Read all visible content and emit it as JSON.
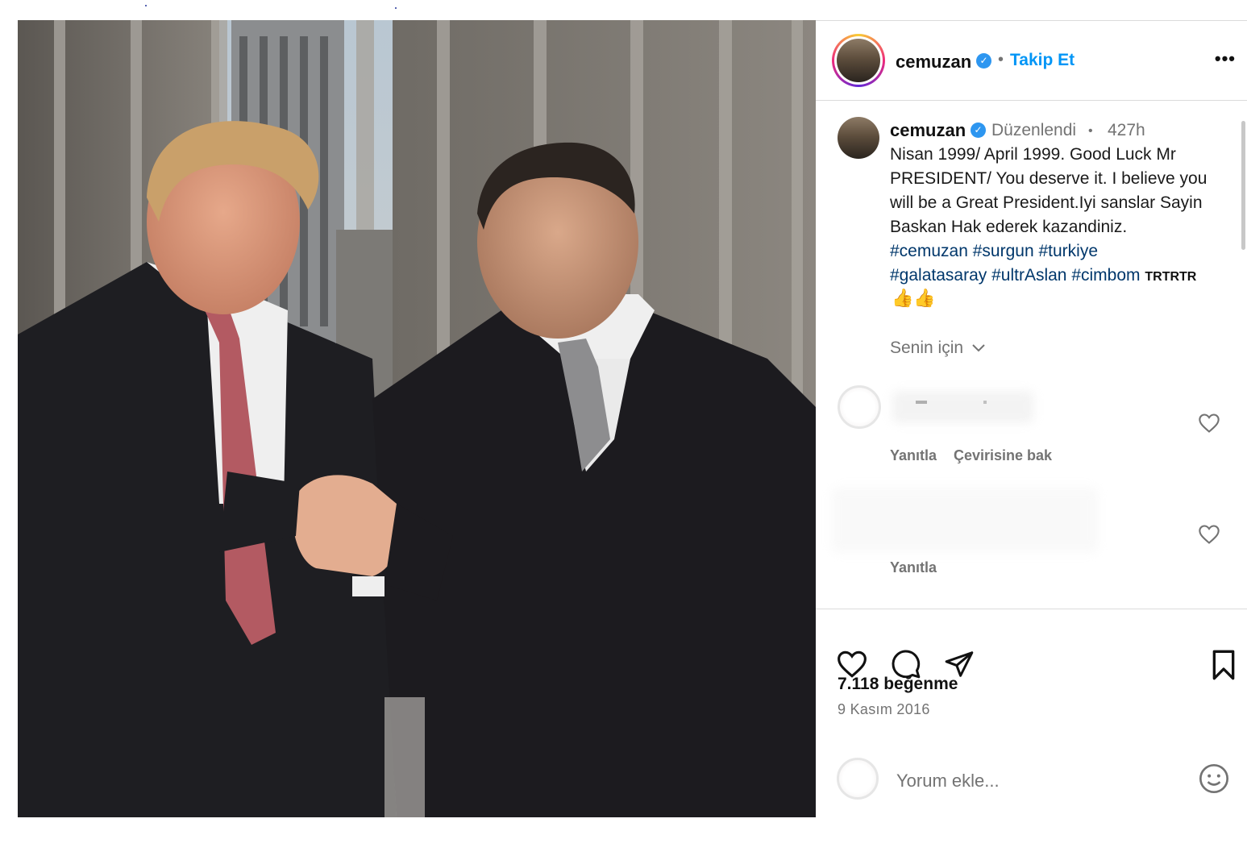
{
  "post": {
    "username": "cemuzan",
    "follow_label": "Takip Et",
    "more_label": "•••",
    "edited_label": "Düzenlendi",
    "time_ago": "427h",
    "caption_text": "Nisan 1999/ April 1999. Good Luck Mr PRESIDENT/ You deserve it. I believe you will be a Great President.Iyi sanslar Sayin Baskan Hak ederek kazandiniz.",
    "hashtags_line1": [
      "#cemuzan",
      "#surgun",
      "#turkiye"
    ],
    "hashtags_line2": [
      "#galatasaray",
      "#ultrAslan",
      "#cimbom"
    ],
    "caption_suffix": "TRTRTR",
    "emoji": "👍👍",
    "for_you_label": "Senin için",
    "likes": "7.118 beğenme",
    "date": "9 Kasım 2016",
    "comment_placeholder": "Yorum ekle..."
  },
  "comments": [
    {
      "reply_label": "Yanıtla",
      "translate_label": "Çevirisine bak"
    },
    {
      "reply_label": "Yanıtla"
    }
  ],
  "icons": {
    "verified": "verified-badge-icon",
    "like": "heart-icon",
    "comment": "comment-bubble-icon",
    "share": "paper-plane-icon",
    "save": "bookmark-icon",
    "emoji": "smiley-icon",
    "more": "more-horizontal-icon",
    "dropdown": "chevron-down-icon"
  },
  "colors": {
    "link": "#0095f6",
    "hashtag": "#00376b",
    "muted": "#737373",
    "verified": "#2d96f0"
  }
}
